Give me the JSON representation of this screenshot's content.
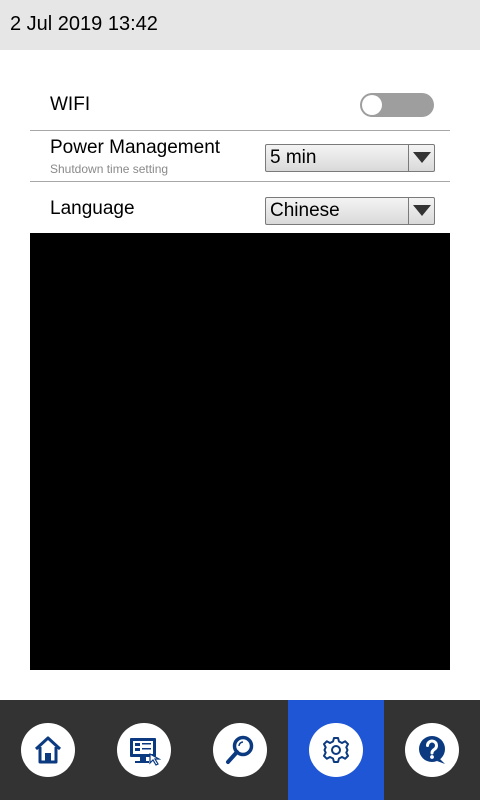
{
  "status_bar": {
    "datetime": "2 Jul 2019 13:42"
  },
  "settings": {
    "wifi": {
      "label": "WIFI",
      "enabled": false
    },
    "power": {
      "label": "Power Management",
      "sublabel": "Shutdown time setting",
      "value": "5 min"
    },
    "language": {
      "label": "Language",
      "value": "Chinese"
    }
  },
  "nav": {
    "items": [
      {
        "icon": "home-icon",
        "active": false
      },
      {
        "icon": "monitor-touch-icon",
        "active": false
      },
      {
        "icon": "search-icon",
        "active": false
      },
      {
        "icon": "gear-icon",
        "active": true
      },
      {
        "icon": "help-icon",
        "active": false
      }
    ],
    "active_color": "#1e56d6",
    "background_color": "#333333",
    "icon_color": "#0b3a80"
  }
}
